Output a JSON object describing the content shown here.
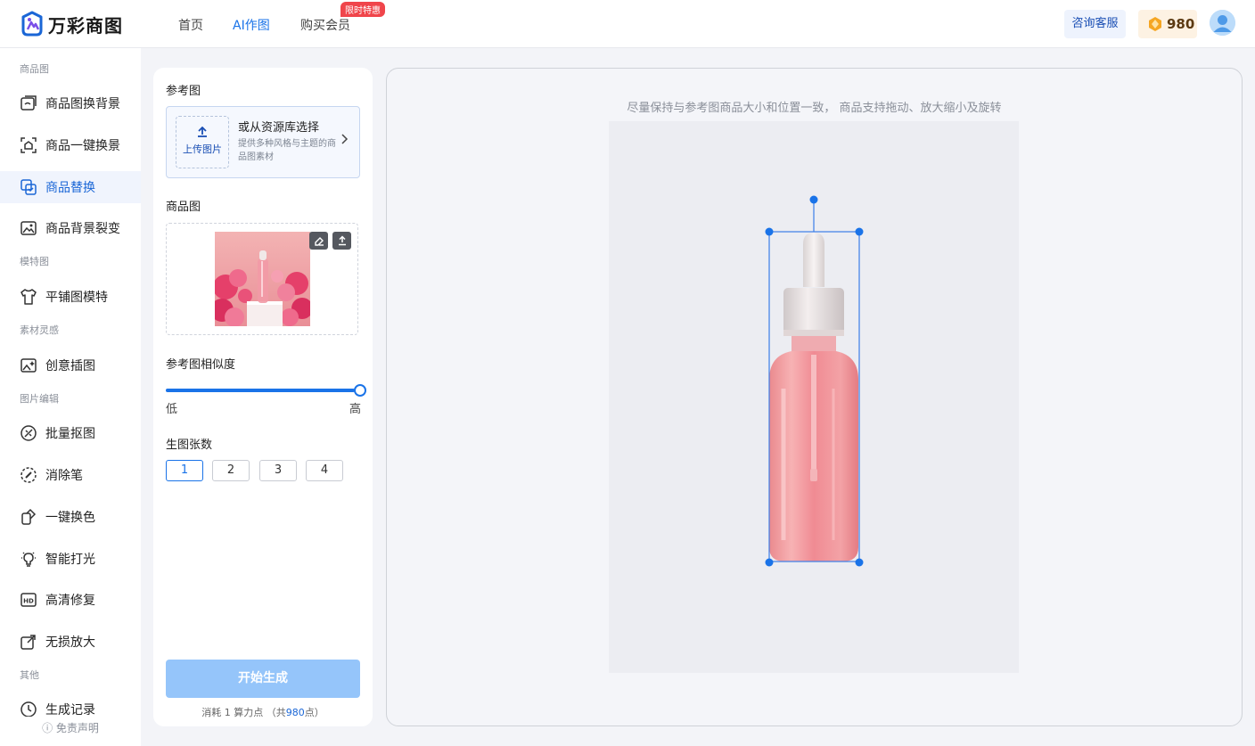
{
  "brand": {
    "name": "万彩商图"
  },
  "nav": {
    "items": [
      {
        "label": "首页"
      },
      {
        "label": "AI作图"
      },
      {
        "label": "购买会员"
      }
    ],
    "promo_badge": "限时特惠"
  },
  "header": {
    "consult_label": "咨询客服",
    "credits": "980"
  },
  "sidebar": {
    "sections": [
      {
        "title": "商品图"
      },
      {
        "title": "模特图"
      },
      {
        "title": "素材灵感"
      },
      {
        "title": "图片编辑"
      },
      {
        "title": "其他"
      }
    ],
    "items": [
      {
        "label": "商品图换背景",
        "icon": "image-swap-icon"
      },
      {
        "label": "商品一键换景",
        "icon": "scene-switch-icon"
      },
      {
        "label": "商品替换",
        "icon": "product-replace-icon"
      },
      {
        "label": "商品背景裂变",
        "icon": "background-variation-icon"
      },
      {
        "label": "平铺图模特",
        "icon": "shirt-model-icon"
      },
      {
        "label": "创意插图",
        "icon": "creative-image-icon"
      },
      {
        "label": "批量抠图",
        "icon": "cutout-icon"
      },
      {
        "label": "消除笔",
        "icon": "eraser-pen-icon"
      },
      {
        "label": "一键换色",
        "icon": "color-swap-icon"
      },
      {
        "label": "智能打光",
        "icon": "lightbulb-icon"
      },
      {
        "label": "高清修复",
        "icon": "hd-icon"
      },
      {
        "label": "无损放大",
        "icon": "upscale-icon"
      },
      {
        "label": "生成记录",
        "icon": "history-icon"
      }
    ],
    "active_item": "商品替换",
    "footer": "免责声明"
  },
  "panel": {
    "reference_label": "参考图",
    "upload_label": "上传图片",
    "library_title": "或从资源库选择",
    "library_desc": "提供多种风格与主题的商品图素材",
    "product_label": "商品图",
    "similarity_label": "参考图相似度",
    "similarity_value": 1.0,
    "similarity_low": "低",
    "similarity_high": "高",
    "count_label": "生图张数",
    "count_options": [
      "1",
      "2",
      "3",
      "4"
    ],
    "count_selected": "1",
    "generate_label": "开始生成",
    "cost": {
      "prefix": "消耗",
      "amount": "1",
      "unit": "算力点",
      "total_prefix": "（共",
      "total": "980",
      "total_suffix": "点）"
    }
  },
  "canvas": {
    "hint": "尽量保持与参考图商品大小和位置一致， 商品支持拖动、放大缩小及旋转"
  },
  "colors": {
    "accent": "#1a73e8",
    "primary_button_disabled": "#95c5fa",
    "promo": "#f0454b"
  }
}
